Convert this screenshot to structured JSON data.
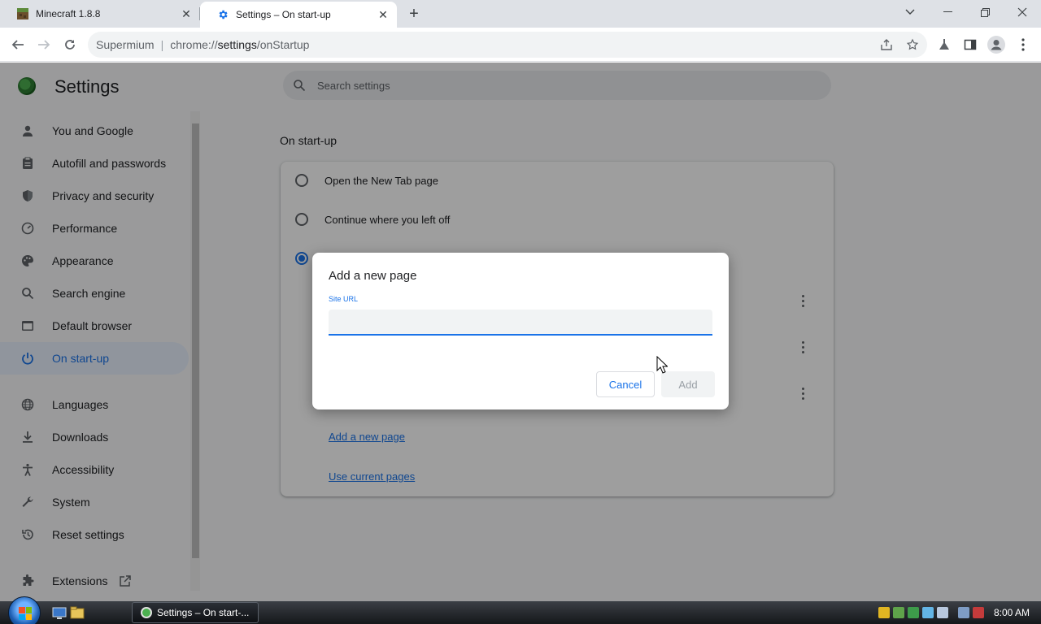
{
  "browser": {
    "tabs": [
      {
        "title": "Minecraft 1.8.8",
        "active": false
      },
      {
        "title": "Settings – On start-up",
        "active": true
      }
    ],
    "omnibox": {
      "site_label": "Supermium",
      "divider": "|",
      "url_scheme": "chrome://",
      "url_host": "settings",
      "url_path": "/onStartup"
    }
  },
  "settings": {
    "title": "Settings",
    "search_placeholder": "Search settings",
    "nav": [
      {
        "label": "You and Google",
        "icon": "person-icon"
      },
      {
        "label": "Autofill and passwords",
        "icon": "clipboard-icon"
      },
      {
        "label": "Privacy and security",
        "icon": "shield-icon"
      },
      {
        "label": "Performance",
        "icon": "speedometer-icon"
      },
      {
        "label": "Appearance",
        "icon": "palette-icon"
      },
      {
        "label": "Search engine",
        "icon": "search-icon"
      },
      {
        "label": "Default browser",
        "icon": "browser-icon"
      },
      {
        "label": "On start-up",
        "icon": "power-icon",
        "active": true
      },
      {
        "label": "Languages",
        "icon": "globe-icon"
      },
      {
        "label": "Downloads",
        "icon": "download-icon"
      },
      {
        "label": "Accessibility",
        "icon": "accessibility-icon"
      },
      {
        "label": "System",
        "icon": "wrench-icon"
      },
      {
        "label": "Reset settings",
        "icon": "reset-icon"
      },
      {
        "label": "Extensions",
        "icon": "puzzle-icon"
      }
    ],
    "section_title": "On start-up",
    "options": [
      {
        "label": "Open the New Tab page",
        "checked": false
      },
      {
        "label": "Continue where you left off",
        "checked": false
      },
      {
        "label": "",
        "checked": true
      }
    ],
    "links": {
      "add_page": "Add a new page",
      "use_current": "Use current pages"
    }
  },
  "dialog": {
    "title": "Add a new page",
    "field_label": "Site URL",
    "field_value": "",
    "cancel_label": "Cancel",
    "add_label": "Add",
    "add_enabled": false
  },
  "taskbar": {
    "task_title": "Settings – On start-...",
    "clock": "8:00 AM"
  },
  "colors": {
    "accent": "#1a73e8",
    "tabstrip": "#dee1e6",
    "taskbar": "#15171a"
  }
}
